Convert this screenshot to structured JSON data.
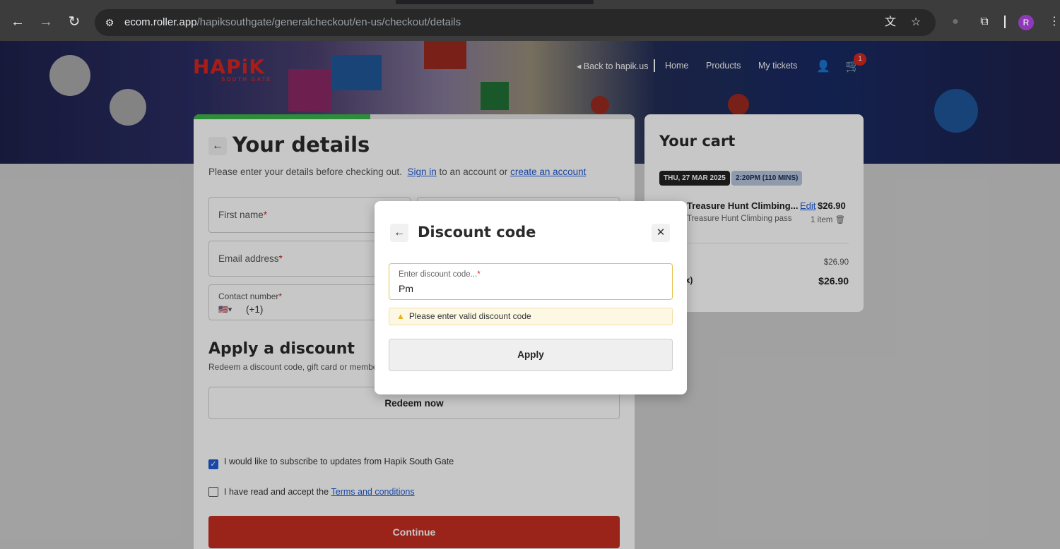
{
  "browser": {
    "url_host": "ecom.roller.app",
    "url_path": "/hapiksouthgate/generalcheckout/en-us/checkout/details",
    "profile_initial": "R"
  },
  "header": {
    "logo_text": "HAPiK",
    "logo_sub": "SOUTH GATE",
    "nav": {
      "back": "Back to hapik.us",
      "home": "Home",
      "products": "Products",
      "my_tickets": "My tickets"
    },
    "cart_count": "1"
  },
  "details": {
    "progress_percent": 40,
    "title": "Your details",
    "subtitle_prefix": "Please enter your details before checking out.",
    "sign_in": "Sign in",
    "subtitle_mid": "to an account or",
    "create_account": "create an account",
    "first_name_label": "First name",
    "email_label": "Email address",
    "contact_label": "Contact number",
    "dial_code": "(+1)",
    "discount_title": "Apply a discount",
    "discount_sub": "Redeem a discount code, gift card or member",
    "redeem_button": "Redeem now",
    "subscribe_label": "I would like to subscribe to updates from Hapik South Gate",
    "terms_prefix": "I have read and accept the",
    "terms_link": "Terms and conditions",
    "continue_button": "Continue"
  },
  "cart": {
    "title": "Your cart",
    "date_tag": "THU, 27 MAR 2025",
    "time_tag": "2:20PM (110 MINS)",
    "item_name": "Treasure Hunt Climbing...",
    "item_edit": "Edit",
    "item_price": "$26.90",
    "item_sub": "Treasure Hunt Climbing pass",
    "item_qty": "1 item",
    "subtotal_label": "l",
    "subtotal_value": "$26.90",
    "total_label": "(inc. tax)",
    "total_value": "$26.90"
  },
  "modal": {
    "title": "Discount code",
    "input_label": "Enter discount code...",
    "input_value": "Pm",
    "warning": "Please enter valid discount code",
    "apply_button": "Apply"
  },
  "colors": {
    "brand_red": "#c62e22",
    "progress_green": "#3bb54a",
    "link_blue": "#1f5bd6",
    "warning_border": "#e6c14a"
  }
}
